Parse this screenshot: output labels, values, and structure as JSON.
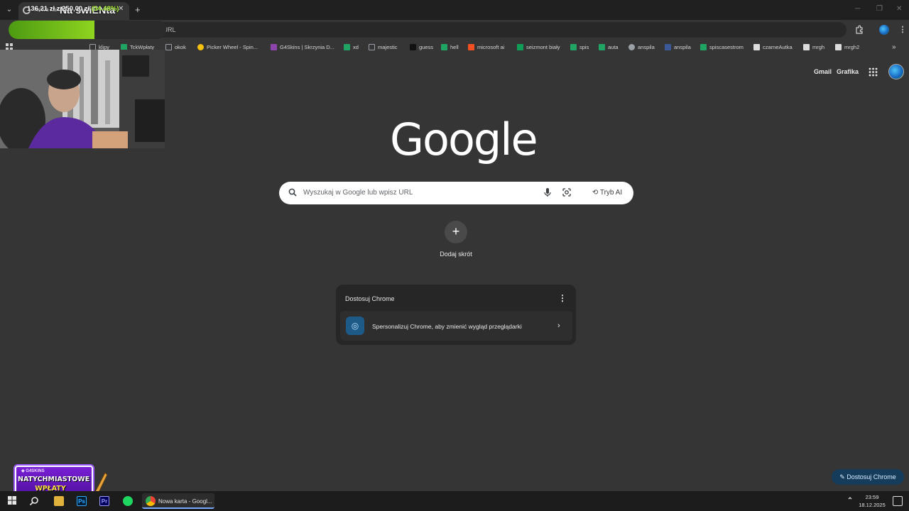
{
  "browser": {
    "tab_title": "Nowa karta",
    "new_tab_label": "+",
    "close_label": "✕",
    "omnibox_placeholder": "Wyszukaj w Google lub wpisz URL",
    "omnibox_visible_text": "b wpisz URL"
  },
  "stream_overlay": {
    "title": "Na świENta",
    "goal": {
      "current": "136,21 zł",
      "separator": "z",
      "target": "250,00 zł",
      "percent_label": "(54.48%)",
      "progress": 0.5448
    },
    "promo_brand": "G4SKINS",
    "promo_line1": "NATYCHMIASTOWE",
    "promo_line2": "WPŁATY SKINAMI!"
  },
  "bookmarks": [
    {
      "label": "klipy",
      "icon": "folder-icon",
      "color": "#9aa0a6"
    },
    {
      "label": "TckWpłaty",
      "icon": "sheets-icon",
      "color": "#1fa463"
    },
    {
      "label": "okok",
      "icon": "folder-icon",
      "color": "#9aa0a6"
    },
    {
      "label": "Picker Wheel - Spin...",
      "icon": "wheel-icon",
      "color": "#f4c20d"
    },
    {
      "label": "G4Skins | Skrzynia D...",
      "icon": "g4skins-icon",
      "color": "#8e44ad"
    },
    {
      "label": "xd",
      "icon": "sheets-icon",
      "color": "#1fa463"
    },
    {
      "label": "majestic",
      "icon": "folder-icon",
      "color": "#9aa0a6"
    },
    {
      "label": "guess",
      "icon": "n-icon",
      "color": "#111111"
    },
    {
      "label": "hell",
      "icon": "sheets-icon",
      "color": "#1fa463"
    },
    {
      "label": "microsoft ai",
      "icon": "microsoft-icon",
      "color": "#f25022"
    },
    {
      "label": "seizmont biały",
      "icon": "sheet-green-icon",
      "color": "#0f9d58"
    },
    {
      "label": "spis",
      "icon": "sheets-icon",
      "color": "#1fa463"
    },
    {
      "label": "auta",
      "icon": "sheets-icon",
      "color": "#1fa463"
    },
    {
      "label": "anspila",
      "icon": "globe-icon",
      "color": "#9aa0a6"
    },
    {
      "label": "anspila",
      "icon": "r-icon",
      "color": "#3b5998"
    },
    {
      "label": "spiscasestrom",
      "icon": "sheets-icon",
      "color": "#1fa463"
    },
    {
      "label": "czarneAutka",
      "icon": "doc-icon",
      "color": "#dddddd"
    },
    {
      "label": "mrgh",
      "icon": "diamond-icon",
      "color": "#dddddd"
    },
    {
      "label": "mrgh2",
      "icon": "triangle-icon",
      "color": "#dddddd"
    }
  ],
  "google": {
    "logo": "Google",
    "gmail": "Gmail",
    "images": "Grafika",
    "ai_mode": "Tryb AI",
    "add_shortcut": "Dodaj skrót",
    "card_title": "Dostosuj Chrome",
    "card_row": "Spersonalizuj Chrome, aby zmienić wygląd przeglądarki",
    "customize_button": "Dostosuj Chrome"
  },
  "taskbar": {
    "chrome_task": "Nowa karta - Googl...",
    "time": "23:59",
    "date": "18.12.2025",
    "ps_label": "Ps",
    "pr_label": "Pr"
  },
  "colors": {
    "page_bg": "#353535",
    "goal_fill": "#8fd41f",
    "promo_bg": "#7a1fd6",
    "customize_button_bg": "#163c5c"
  }
}
